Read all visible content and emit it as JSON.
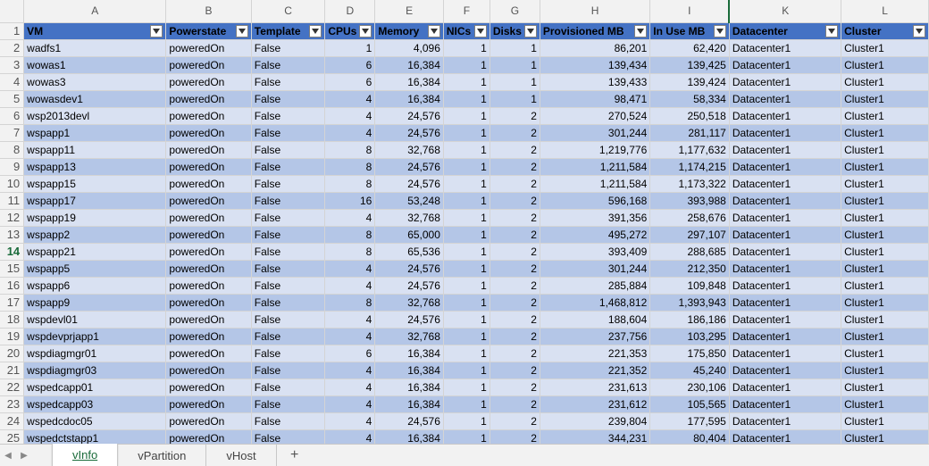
{
  "columns": [
    {
      "letter": "A"
    },
    {
      "letter": "B"
    },
    {
      "letter": "C"
    },
    {
      "letter": "D"
    },
    {
      "letter": "E"
    },
    {
      "letter": "F"
    },
    {
      "letter": "G"
    },
    {
      "letter": "H"
    },
    {
      "letter": "I"
    },
    {
      "letter": "K"
    },
    {
      "letter": "L"
    }
  ],
  "headers": [
    "VM",
    "Powerstate",
    "Template",
    "CPUs",
    "Memory",
    "NICs",
    "Disks",
    "Provisioned MB",
    "In Use MB",
    "Datacenter",
    "Cluster"
  ],
  "header_row_number": "1",
  "active_row_number": "14",
  "rows": [
    [
      "2",
      "wadfs1",
      "poweredOn",
      "False",
      "1",
      "4,096",
      "1",
      "1",
      "86,201",
      "62,420",
      "Datacenter1",
      "Cluster1"
    ],
    [
      "3",
      "wowas1",
      "poweredOn",
      "False",
      "6",
      "16,384",
      "1",
      "1",
      "139,434",
      "139,425",
      "Datacenter1",
      "Cluster1"
    ],
    [
      "4",
      "wowas3",
      "poweredOn",
      "False",
      "6",
      "16,384",
      "1",
      "1",
      "139,433",
      "139,424",
      "Datacenter1",
      "Cluster1"
    ],
    [
      "5",
      "wowasdev1",
      "poweredOn",
      "False",
      "4",
      "16,384",
      "1",
      "1",
      "98,471",
      "58,334",
      "Datacenter1",
      "Cluster1"
    ],
    [
      "6",
      "wsp2013devl",
      "poweredOn",
      "False",
      "4",
      "24,576",
      "1",
      "2",
      "270,524",
      "250,518",
      "Datacenter1",
      "Cluster1"
    ],
    [
      "7",
      "wspapp1",
      "poweredOn",
      "False",
      "4",
      "24,576",
      "1",
      "2",
      "301,244",
      "281,117",
      "Datacenter1",
      "Cluster1"
    ],
    [
      "8",
      "wspapp11",
      "poweredOn",
      "False",
      "8",
      "32,768",
      "1",
      "2",
      "1,219,776",
      "1,177,632",
      "Datacenter1",
      "Cluster1"
    ],
    [
      "9",
      "wspapp13",
      "poweredOn",
      "False",
      "8",
      "24,576",
      "1",
      "2",
      "1,211,584",
      "1,174,215",
      "Datacenter1",
      "Cluster1"
    ],
    [
      "10",
      "wspapp15",
      "poweredOn",
      "False",
      "8",
      "24,576",
      "1",
      "2",
      "1,211,584",
      "1,173,322",
      "Datacenter1",
      "Cluster1"
    ],
    [
      "11",
      "wspapp17",
      "poweredOn",
      "False",
      "16",
      "53,248",
      "1",
      "2",
      "596,168",
      "393,988",
      "Datacenter1",
      "Cluster1"
    ],
    [
      "12",
      "wspapp19",
      "poweredOn",
      "False",
      "4",
      "32,768",
      "1",
      "2",
      "391,356",
      "258,676",
      "Datacenter1",
      "Cluster1"
    ],
    [
      "13",
      "wspapp2",
      "poweredOn",
      "False",
      "8",
      "65,000",
      "1",
      "2",
      "495,272",
      "297,107",
      "Datacenter1",
      "Cluster1"
    ],
    [
      "14",
      "wspapp21",
      "poweredOn",
      "False",
      "8",
      "65,536",
      "1",
      "2",
      "393,409",
      "288,685",
      "Datacenter1",
      "Cluster1"
    ],
    [
      "15",
      "wspapp5",
      "poweredOn",
      "False",
      "4",
      "24,576",
      "1",
      "2",
      "301,244",
      "212,350",
      "Datacenter1",
      "Cluster1"
    ],
    [
      "16",
      "wspapp6",
      "poweredOn",
      "False",
      "4",
      "24,576",
      "1",
      "2",
      "285,884",
      "109,848",
      "Datacenter1",
      "Cluster1"
    ],
    [
      "17",
      "wspapp9",
      "poweredOn",
      "False",
      "8",
      "32,768",
      "1",
      "2",
      "1,468,812",
      "1,393,943",
      "Datacenter1",
      "Cluster1"
    ],
    [
      "18",
      "wspdevl01",
      "poweredOn",
      "False",
      "4",
      "24,576",
      "1",
      "2",
      "188,604",
      "186,186",
      "Datacenter1",
      "Cluster1"
    ],
    [
      "19",
      "wspdevprjapp1",
      "poweredOn",
      "False",
      "4",
      "32,768",
      "1",
      "2",
      "237,756",
      "103,295",
      "Datacenter1",
      "Cluster1"
    ],
    [
      "20",
      "wspdiagmgr01",
      "poweredOn",
      "False",
      "6",
      "16,384",
      "1",
      "2",
      "221,353",
      "175,850",
      "Datacenter1",
      "Cluster1"
    ],
    [
      "21",
      "wspdiagmgr03",
      "poweredOn",
      "False",
      "4",
      "16,384",
      "1",
      "2",
      "221,352",
      "45,240",
      "Datacenter1",
      "Cluster1"
    ],
    [
      "22",
      "wspedcapp01",
      "poweredOn",
      "False",
      "4",
      "16,384",
      "1",
      "2",
      "231,613",
      "230,106",
      "Datacenter1",
      "Cluster1"
    ],
    [
      "23",
      "wspedcapp03",
      "poweredOn",
      "False",
      "4",
      "16,384",
      "1",
      "2",
      "231,612",
      "105,565",
      "Datacenter1",
      "Cluster1"
    ],
    [
      "24",
      "wspedcdoc05",
      "poweredOn",
      "False",
      "4",
      "24,576",
      "1",
      "2",
      "239,804",
      "177,595",
      "Datacenter1",
      "Cluster1"
    ],
    [
      "25",
      "wspedctstapp1",
      "poweredOn",
      "False",
      "4",
      "16,384",
      "1",
      "2",
      "344,231",
      "80,404",
      "Datacenter1",
      "Cluster1"
    ]
  ],
  "tabs": [
    {
      "label": "vInfo",
      "active": true
    },
    {
      "label": "vPartition",
      "active": false
    },
    {
      "label": "vHost",
      "active": false
    }
  ],
  "add_sheet_label": "+",
  "icons": {
    "filter": "filter-dropdown-icon",
    "prev": "sheet-prev-icon",
    "next": "sheet-next-icon"
  },
  "colors": {
    "header_fill": "#4472c4",
    "band_light": "#d9e1f2",
    "band_dark": "#b4c6e7",
    "active_accent": "#1a6b3a"
  }
}
